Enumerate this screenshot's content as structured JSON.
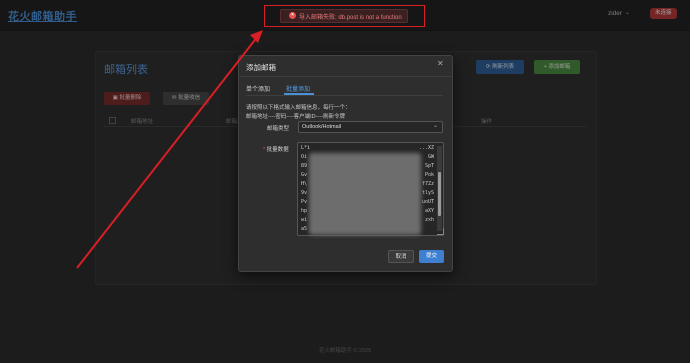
{
  "header": {
    "app_title": "花火邮箱助手",
    "user": "zider",
    "status": "未连接"
  },
  "toast": {
    "message": "导入邮箱失败: db.post is not a function",
    "type": "error",
    "color": "#e35050"
  },
  "panel": {
    "title": "邮箱列表",
    "refresh_button": "刷新列表",
    "add_button": "+ 添加邮箱",
    "batch_delete_button": "批量删除",
    "batch_receive_button": "批量收信",
    "table_columns": [
      "邮箱地址",
      "邮箱地址",
      "操作"
    ]
  },
  "dialog": {
    "title": "添加邮箱",
    "tabs": [
      {
        "label": "单个添加",
        "active": false
      },
      {
        "label": "批量添加",
        "active": true
      }
    ],
    "hint_line1": "请按照以下格式输入邮箱信息，每行一个：",
    "hint_line2": "邮箱地址----密码----客户端ID----刷新令牌",
    "type_label": "邮箱类型",
    "type_value": "Outlook/Hotmail",
    "data_label": "批量数据",
    "data_lines_left": [
      "L*i",
      "Oi",
      "89",
      "Gv",
      "H\\",
      "9v",
      "Pv",
      "hp",
      "wi",
      "a5"
    ],
    "data_first_line_right": "...XZ",
    "data_lines_right": [
      "GW",
      "SpT",
      "Pok",
      "f7Zz",
      "tlyS",
      "uoUT",
      "aXY",
      "zxh"
    ],
    "cancel_button": "取消",
    "submit_button": "提交"
  },
  "footer": {
    "text": "花火邮箱助手 © 2025"
  },
  "colors": {
    "accent": "#4b8fd6",
    "annotation": "#d81f26",
    "success": "#4b8a3f",
    "danger": "#b33a3a"
  }
}
